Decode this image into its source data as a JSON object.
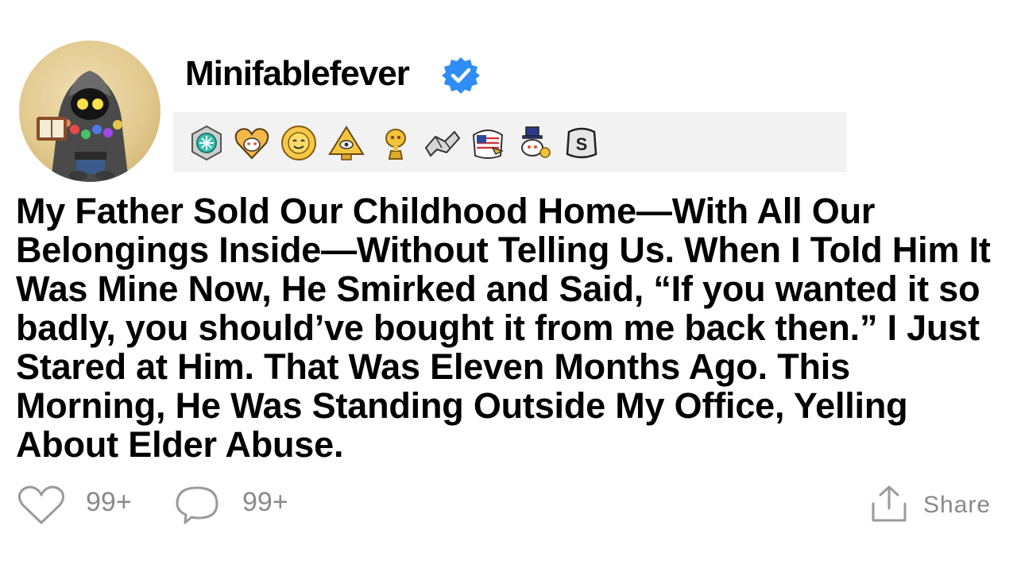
{
  "post": {
    "username": "Minifablefever",
    "verified": true,
    "title": "My Father Sold Our Childhood Home—With All Our Belongings Inside—Without Telling Us. When I Told Him It Was Mine Now, He Smirked and Said, “If you wanted it so badly, you should’ve bought it from me back then.” I Just Stared at Him. That Was Eleven Months Ago. This Morning, He Was Standing Outside My Office, Yelling About Elder Abuse."
  },
  "awards": [
    {
      "icon": "silver-badge-award-icon"
    },
    {
      "icon": "heart-snoo-award-icon"
    },
    {
      "icon": "sun-face-award-icon"
    },
    {
      "icon": "pyramid-eye-award-icon"
    },
    {
      "icon": "gold-snoo-trophy-award-icon"
    },
    {
      "icon": "handshake-award-icon"
    },
    {
      "icon": "eagle-flag-award-icon"
    },
    {
      "icon": "snoo-top-hat-award-icon"
    },
    {
      "icon": "silver-s-award-icon"
    }
  ],
  "actions": {
    "like_count": "99+",
    "comment_count": "99+",
    "share_label": "Share"
  },
  "colors": {
    "verified_blue": "#2f8df5",
    "muted_text": "#8a8a8a",
    "awards_background": "#f2f2f2"
  }
}
